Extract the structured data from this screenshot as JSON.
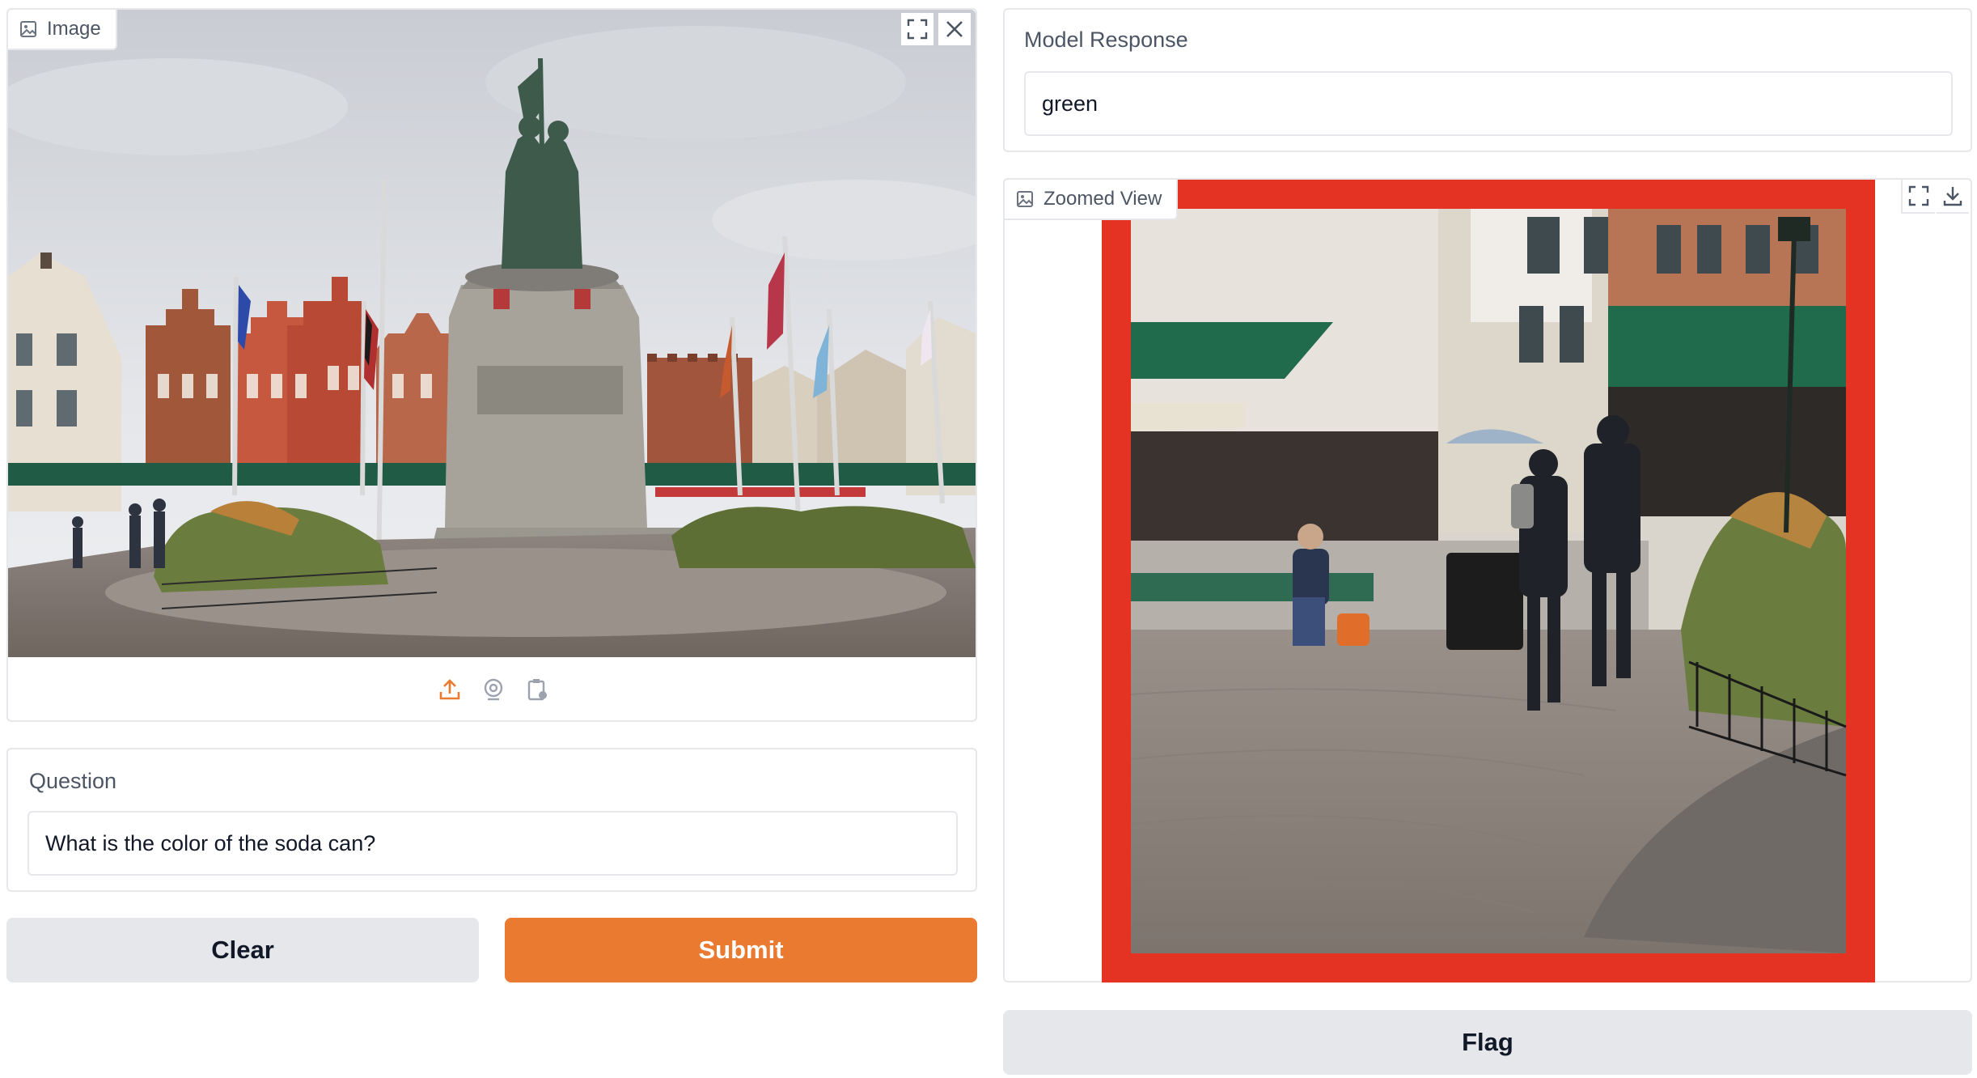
{
  "image_panel": {
    "label": "Image",
    "photo_description": "Market square with statue and flags"
  },
  "question": {
    "label": "Question",
    "value": "What is the color of the soda can?"
  },
  "buttons": {
    "clear": "Clear",
    "submit": "Submit",
    "flag": "Flag"
  },
  "response": {
    "label": "Model Response",
    "value": "green"
  },
  "zoomed": {
    "label": "Zoomed View"
  },
  "colors": {
    "accent": "#ea7a30",
    "zoom_frame": "#e53323",
    "awning": "#1f6b4c"
  }
}
